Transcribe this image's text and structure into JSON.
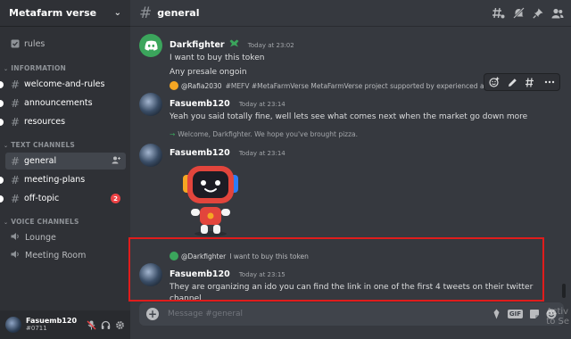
{
  "server": {
    "name": "Metafarm verse"
  },
  "sidebar": {
    "rules": "rules",
    "categories": {
      "information": "INFORMATION",
      "text": "TEXT CHANNELS",
      "voice": "VOICE CHANNELS"
    },
    "channels": {
      "welcome": "welcome-and-rules",
      "announcements": "announcements",
      "resources": "resources",
      "general": "general",
      "meeting": "meeting-plans",
      "offtopic": "off-topic",
      "offtopic_badge": "2",
      "lounge": "Lounge",
      "meeting_room": "Meeting Room"
    }
  },
  "user": {
    "name": "Fasuemb120",
    "tag": "#0711"
  },
  "channel": {
    "name": "general"
  },
  "messages": {
    "m1": {
      "author": "Darkfighter",
      "time": "Today at 23:02",
      "line1": "I want to buy this token",
      "line2": "Any presale ongoin"
    },
    "m2": {
      "reply_author": "@Rafia2030",
      "reply_text": "#MEFV #MetaFarmVerse  MetaFarmVerse project supported by experienced and highly",
      "author": "Fasuemb120",
      "time": "Today at 23:14",
      "text": "Yeah you said totally fine, well lets see what comes next when the market go down more"
    },
    "m3": {
      "system": "Welcome, Darkfighter. We hope you've brought pizza.",
      "author": "Fasuemb120",
      "time": "Today at 23:14"
    },
    "m4": {
      "reply_author": "@Darkfighter",
      "reply_text": "I want to buy this token",
      "author": "Fasuemb120",
      "time": "Today at 23:15",
      "text": "They are organizing an ido you can find the link in one of the first 4 tweets on their twitter channel"
    }
  },
  "composer": {
    "placeholder": "Message #general",
    "gif_label": "GIF"
  },
  "watermark": {
    "line1": "Activ",
    "line2": "to Se"
  },
  "colors": {
    "accent": "#5865f2",
    "online": "#3ba55c",
    "mention": "#ed4245",
    "highlight_box": "#e01c1c"
  },
  "icons": [
    "rules-icon",
    "hash-icon",
    "speaker-icon",
    "threads-icon",
    "mute-notification-icon",
    "pin-icon",
    "members-icon",
    "mic-muted-icon",
    "headphones-icon",
    "settings-gear-icon",
    "add-reaction-icon",
    "edit-icon",
    "more-icon",
    "plus-icon",
    "gift-icon",
    "sticker-icon",
    "emoji-icon",
    "discord-logo-icon",
    "robot-sticker"
  ]
}
